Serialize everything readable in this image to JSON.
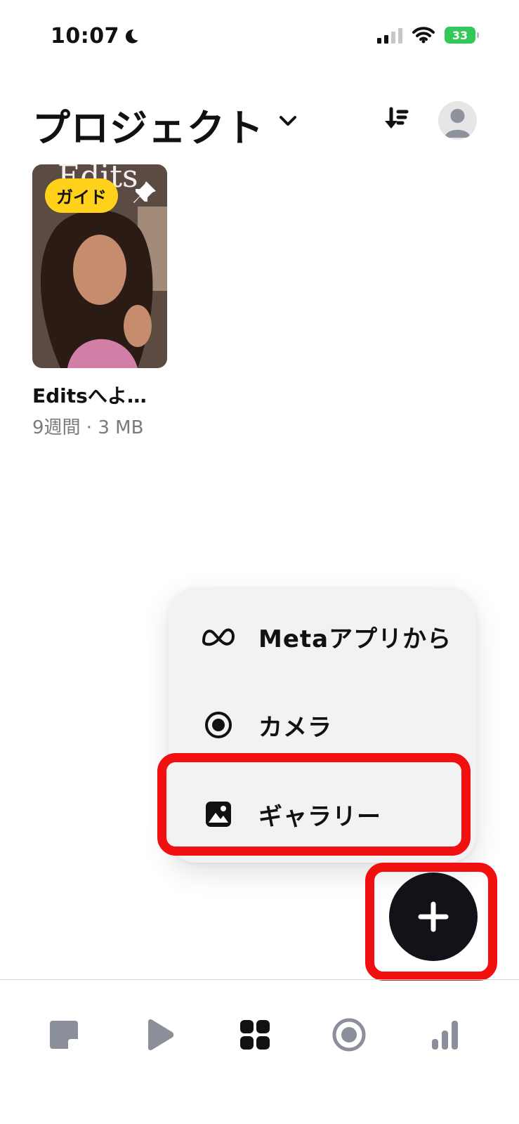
{
  "status_bar": {
    "time": "10:07",
    "battery": "33",
    "icons": [
      "moon-icon",
      "signal-icon",
      "wifi-icon",
      "battery-charging-icon"
    ]
  },
  "header": {
    "title": "プロジェクト",
    "icons": [
      "chevron-down-icon",
      "import-sort-icon",
      "profile-avatar-icon"
    ]
  },
  "projects": [
    {
      "thumb_text": "Edits",
      "badge": "ガイド",
      "title": "Editsへよ…",
      "meta": "9週間 · 3 MB",
      "icons": [
        "pin-icon"
      ]
    }
  ],
  "create_menu": {
    "items": [
      {
        "label": "Metaアプリから",
        "icon": "meta-icon"
      },
      {
        "label": "カメラ",
        "icon": "camera-record-icon"
      },
      {
        "label": "ギャラリー",
        "icon": "gallery-icon"
      }
    ]
  },
  "fab": {
    "icon": "plus-icon"
  },
  "bottom_nav": {
    "items": [
      "notes-icon",
      "play-icon",
      "grid-icon",
      "record-icon",
      "bar-chart-icon"
    ],
    "active": "grid-icon"
  },
  "colors": {
    "badge": "#ffd11a",
    "highlight": "#f01010",
    "battery": "#34c759",
    "fab": "#111319",
    "menu_bg": "#f2f2f4",
    "nav_inactive": "#8a8f99"
  }
}
